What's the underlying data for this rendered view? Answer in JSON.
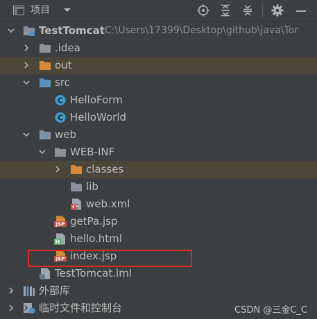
{
  "header": {
    "title": "项目",
    "icons": [
      "project-icon",
      "dropdown-caret-icon",
      "locate-icon",
      "expand-all-icon",
      "collapse-all-icon",
      "gear-icon",
      "minimize-icon"
    ]
  },
  "tree": {
    "root": {
      "label": "TestTomcat",
      "path": "C:\\Users\\17399\\Desktop\\github\\java\\Tor"
    },
    "idea": {
      "label": ".idea"
    },
    "out": {
      "label": "out"
    },
    "src": {
      "label": "src"
    },
    "hello_form": {
      "label": "HelloForm"
    },
    "hello_world": {
      "label": "HelloWorld"
    },
    "web": {
      "label": "web"
    },
    "web_inf": {
      "label": "WEB-INF"
    },
    "classes": {
      "label": "classes"
    },
    "lib": {
      "label": "lib"
    },
    "web_xml": {
      "label": "web.xml"
    },
    "getpa_jsp": {
      "label": "getPa.jsp"
    },
    "hello_html": {
      "label": "hello.html"
    },
    "index_jsp": {
      "label": "index.jsp"
    },
    "iml": {
      "label": "TestTomcat.iml"
    },
    "ext_libs": {
      "label": "外部库"
    },
    "scratches": {
      "label": "临时文件和控制台"
    }
  },
  "file_badges": {
    "jsp": "JSP",
    "html": "H"
  },
  "watermark": "CSDN @三金C_C",
  "colors": {
    "panel_bg": "#3c3f41",
    "text": "#bbbbbb",
    "highlight_row": "#4b4637",
    "folder_gray": "#8a9199",
    "folder_orange": "#d48a3a",
    "folder_blue": "#5d8fbd",
    "class_icon": "#3f9dc9",
    "jsp_badge": "#c75450",
    "html_badge": "#59a869",
    "selection_border": "#d62a2a"
  }
}
